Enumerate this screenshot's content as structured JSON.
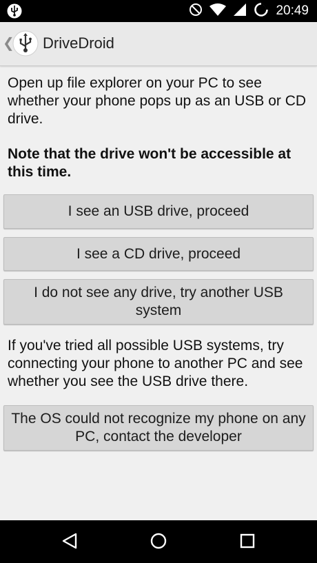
{
  "status_bar": {
    "time": "20:49",
    "icons": [
      "usb-icon",
      "do-not-disturb-icon",
      "wifi-icon",
      "signal-icon",
      "battery-charging-icon"
    ]
  },
  "action_bar": {
    "title": "DriveDroid",
    "icons": [
      "back-chevron-icon",
      "usb-app-icon"
    ]
  },
  "content": {
    "intro": "Open up file explorer on your PC to see whether your phone pops up as an USB or CD drive.",
    "note": "Note that the drive won't be accessible at this time.",
    "buttons": {
      "usb": "I see an USB drive, proceed",
      "cd": "I see a CD drive, proceed",
      "none": "I do not see any drive, try another USB system",
      "contact": "The OS could not recognize my phone on any PC, contact the developer"
    },
    "hint": "If you've tried all possible USB systems, try connecting your phone to another PC and see whether you see the USB drive there."
  },
  "nav_bar": {
    "icons": [
      "back-triangle-icon",
      "home-circle-icon",
      "recents-square-icon"
    ]
  }
}
